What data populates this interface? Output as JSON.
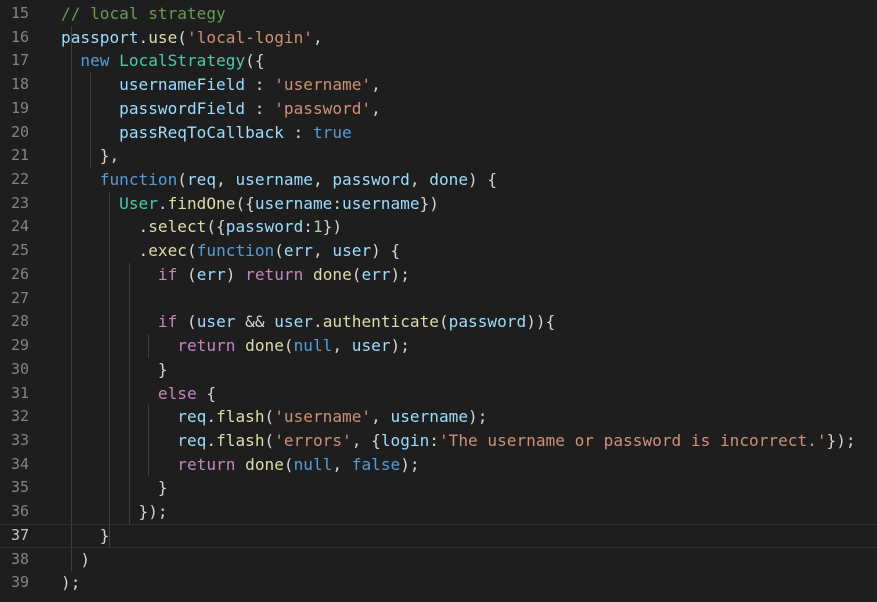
{
  "editor": {
    "lines": [
      {
        "number": "15",
        "tokens": [
          {
            "t": "// local strategy",
            "c": "c"
          }
        ]
      },
      {
        "number": "16",
        "tokens": [
          {
            "t": "passport",
            "c": "v"
          },
          {
            "t": ".",
            "c": "p"
          },
          {
            "t": "use",
            "c": "f"
          },
          {
            "t": "(",
            "c": "p"
          },
          {
            "t": "'local-login'",
            "c": "s"
          },
          {
            "t": ",",
            "c": "p"
          }
        ]
      },
      {
        "number": "17",
        "tokens": [
          {
            "t": "  ",
            "c": "p"
          },
          {
            "t": "new",
            "c": "k"
          },
          {
            "t": " ",
            "c": "p"
          },
          {
            "t": "LocalStrategy",
            "c": "t"
          },
          {
            "t": "({",
            "c": "p"
          }
        ]
      },
      {
        "number": "18",
        "tokens": [
          {
            "t": "      ",
            "c": "p"
          },
          {
            "t": "usernameField",
            "c": "v"
          },
          {
            "t": " : ",
            "c": "p"
          },
          {
            "t": "'username'",
            "c": "s"
          },
          {
            "t": ",",
            "c": "p"
          }
        ]
      },
      {
        "number": "19",
        "tokens": [
          {
            "t": "      ",
            "c": "p"
          },
          {
            "t": "passwordField",
            "c": "v"
          },
          {
            "t": " : ",
            "c": "p"
          },
          {
            "t": "'password'",
            "c": "s"
          },
          {
            "t": ",",
            "c": "p"
          }
        ]
      },
      {
        "number": "20",
        "tokens": [
          {
            "t": "      ",
            "c": "p"
          },
          {
            "t": "passReqToCallback",
            "c": "v"
          },
          {
            "t": " : ",
            "c": "p"
          },
          {
            "t": "true",
            "c": "k"
          }
        ]
      },
      {
        "number": "21",
        "tokens": [
          {
            "t": "    },",
            "c": "p"
          }
        ]
      },
      {
        "number": "22",
        "tokens": [
          {
            "t": "    ",
            "c": "p"
          },
          {
            "t": "function",
            "c": "k"
          },
          {
            "t": "(",
            "c": "p"
          },
          {
            "t": "req",
            "c": "v"
          },
          {
            "t": ", ",
            "c": "p"
          },
          {
            "t": "username",
            "c": "v"
          },
          {
            "t": ", ",
            "c": "p"
          },
          {
            "t": "password",
            "c": "v"
          },
          {
            "t": ", ",
            "c": "p"
          },
          {
            "t": "done",
            "c": "v"
          },
          {
            "t": ") {",
            "c": "p"
          }
        ]
      },
      {
        "number": "23",
        "tokens": [
          {
            "t": "      ",
            "c": "p"
          },
          {
            "t": "User",
            "c": "t"
          },
          {
            "t": ".",
            "c": "p"
          },
          {
            "t": "findOne",
            "c": "f"
          },
          {
            "t": "({",
            "c": "p"
          },
          {
            "t": "username",
            "c": "v"
          },
          {
            "t": ":",
            "c": "p"
          },
          {
            "t": "username",
            "c": "v"
          },
          {
            "t": "})",
            "c": "p"
          }
        ]
      },
      {
        "number": "24",
        "tokens": [
          {
            "t": "        .",
            "c": "p"
          },
          {
            "t": "select",
            "c": "f"
          },
          {
            "t": "({",
            "c": "p"
          },
          {
            "t": "password",
            "c": "v"
          },
          {
            "t": ":",
            "c": "p"
          },
          {
            "t": "1",
            "c": "n"
          },
          {
            "t": "})",
            "c": "p"
          }
        ]
      },
      {
        "number": "25",
        "tokens": [
          {
            "t": "        .",
            "c": "p"
          },
          {
            "t": "exec",
            "c": "f"
          },
          {
            "t": "(",
            "c": "p"
          },
          {
            "t": "function",
            "c": "k"
          },
          {
            "t": "(",
            "c": "p"
          },
          {
            "t": "err",
            "c": "v"
          },
          {
            "t": ", ",
            "c": "p"
          },
          {
            "t": "user",
            "c": "v"
          },
          {
            "t": ") {",
            "c": "p"
          }
        ]
      },
      {
        "number": "26",
        "tokens": [
          {
            "t": "          ",
            "c": "p"
          },
          {
            "t": "if",
            "c": "ctl"
          },
          {
            "t": " (",
            "c": "p"
          },
          {
            "t": "err",
            "c": "v"
          },
          {
            "t": ") ",
            "c": "p"
          },
          {
            "t": "return",
            "c": "ctl"
          },
          {
            "t": " ",
            "c": "p"
          },
          {
            "t": "done",
            "c": "f"
          },
          {
            "t": "(",
            "c": "p"
          },
          {
            "t": "err",
            "c": "v"
          },
          {
            "t": ");",
            "c": "p"
          }
        ]
      },
      {
        "number": "27",
        "tokens": []
      },
      {
        "number": "28",
        "tokens": [
          {
            "t": "          ",
            "c": "p"
          },
          {
            "t": "if",
            "c": "ctl"
          },
          {
            "t": " (",
            "c": "p"
          },
          {
            "t": "user",
            "c": "v"
          },
          {
            "t": " && ",
            "c": "p"
          },
          {
            "t": "user",
            "c": "v"
          },
          {
            "t": ".",
            "c": "p"
          },
          {
            "t": "authenticate",
            "c": "f"
          },
          {
            "t": "(",
            "c": "p"
          },
          {
            "t": "password",
            "c": "v"
          },
          {
            "t": ")){",
            "c": "p"
          }
        ]
      },
      {
        "number": "29",
        "tokens": [
          {
            "t": "            ",
            "c": "p"
          },
          {
            "t": "return",
            "c": "ctl"
          },
          {
            "t": " ",
            "c": "p"
          },
          {
            "t": "done",
            "c": "f"
          },
          {
            "t": "(",
            "c": "p"
          },
          {
            "t": "null",
            "c": "k"
          },
          {
            "t": ", ",
            "c": "p"
          },
          {
            "t": "user",
            "c": "v"
          },
          {
            "t": ");",
            "c": "p"
          }
        ]
      },
      {
        "number": "30",
        "tokens": [
          {
            "t": "          }",
            "c": "p"
          }
        ]
      },
      {
        "number": "31",
        "tokens": [
          {
            "t": "          ",
            "c": "p"
          },
          {
            "t": "else",
            "c": "ctl"
          },
          {
            "t": " {",
            "c": "p"
          }
        ]
      },
      {
        "number": "32",
        "tokens": [
          {
            "t": "            ",
            "c": "p"
          },
          {
            "t": "req",
            "c": "v"
          },
          {
            "t": ".",
            "c": "p"
          },
          {
            "t": "flash",
            "c": "f"
          },
          {
            "t": "(",
            "c": "p"
          },
          {
            "t": "'username'",
            "c": "s"
          },
          {
            "t": ", ",
            "c": "p"
          },
          {
            "t": "username",
            "c": "v"
          },
          {
            "t": ");",
            "c": "p"
          }
        ]
      },
      {
        "number": "33",
        "tokens": [
          {
            "t": "            ",
            "c": "p"
          },
          {
            "t": "req",
            "c": "v"
          },
          {
            "t": ".",
            "c": "p"
          },
          {
            "t": "flash",
            "c": "f"
          },
          {
            "t": "(",
            "c": "p"
          },
          {
            "t": "'errors'",
            "c": "s"
          },
          {
            "t": ", {",
            "c": "p"
          },
          {
            "t": "login",
            "c": "v"
          },
          {
            "t": ":",
            "c": "p"
          },
          {
            "t": "'The username or password is incorrect.'",
            "c": "s"
          },
          {
            "t": "});",
            "c": "p"
          }
        ]
      },
      {
        "number": "34",
        "tokens": [
          {
            "t": "            ",
            "c": "p"
          },
          {
            "t": "return",
            "c": "ctl"
          },
          {
            "t": " ",
            "c": "p"
          },
          {
            "t": "done",
            "c": "f"
          },
          {
            "t": "(",
            "c": "p"
          },
          {
            "t": "null",
            "c": "k"
          },
          {
            "t": ", ",
            "c": "p"
          },
          {
            "t": "false",
            "c": "k"
          },
          {
            "t": ");",
            "c": "p"
          }
        ]
      },
      {
        "number": "35",
        "tokens": [
          {
            "t": "          }",
            "c": "p"
          }
        ]
      },
      {
        "number": "36",
        "tokens": [
          {
            "t": "        });",
            "c": "p"
          }
        ]
      },
      {
        "number": "37",
        "tokens": [
          {
            "t": "    }",
            "c": "p"
          }
        ],
        "current": true
      },
      {
        "number": "38",
        "tokens": [
          {
            "t": "  )",
            "c": "p"
          }
        ]
      },
      {
        "number": "39",
        "tokens": [
          {
            "t": ");",
            "c": "p"
          }
        ]
      }
    ]
  },
  "theme": {
    "background": "#1e1e1e",
    "comment": "#6a9955",
    "string": "#ce9178",
    "keyword": "#569cd6",
    "control": "#c586c0",
    "function": "#dcdcaa",
    "variable": "#9cdcfe",
    "type": "#4ec9b0",
    "number": "#b5cea8",
    "line_number": "#858585"
  }
}
